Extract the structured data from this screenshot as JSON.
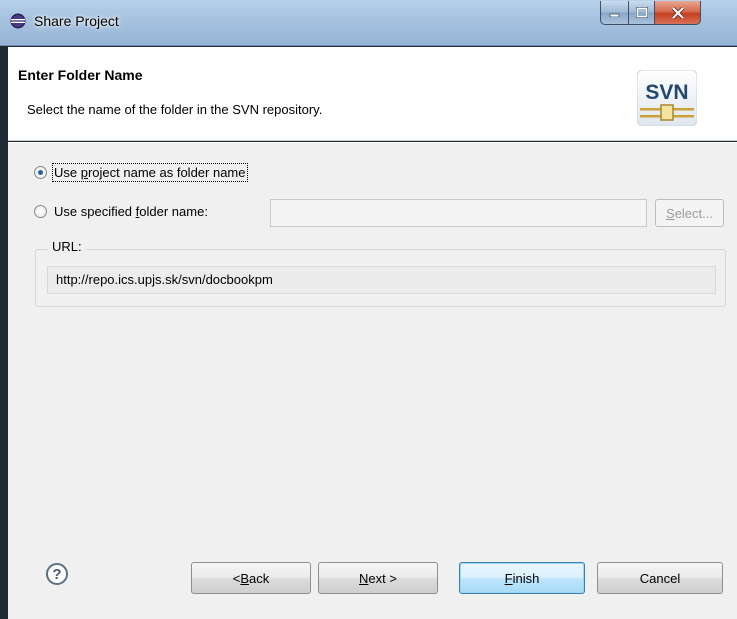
{
  "window": {
    "title": "Share Project"
  },
  "header": {
    "title": "Enter Folder Name",
    "description": "Select the name of the folder in the SVN repository.",
    "logo_text": "SVN"
  },
  "options": {
    "use_project_name": {
      "label_pre": "Use ",
      "label_mn": "p",
      "label_post": "roject name as folder name",
      "checked": true
    },
    "use_specified": {
      "label_pre": "Use specified ",
      "label_mn": "f",
      "label_post": "older name:",
      "checked": false,
      "value": ""
    },
    "select_button": {
      "mn": "S",
      "rest": "elect..."
    }
  },
  "url_group": {
    "label": "URL:",
    "value": "http://repo.ics.upjs.sk/svn/docbookpm"
  },
  "footer": {
    "help": "?",
    "back": {
      "pre": "< ",
      "mn": "B",
      "post": "ack"
    },
    "next": {
      "pre": "",
      "mn": "N",
      "post": "ext >"
    },
    "finish": {
      "pre": "",
      "mn": "F",
      "post": "inish"
    },
    "cancel": "Cancel"
  },
  "colors": {
    "accent": "#3c7fb1",
    "close_button": "#c3401f"
  }
}
